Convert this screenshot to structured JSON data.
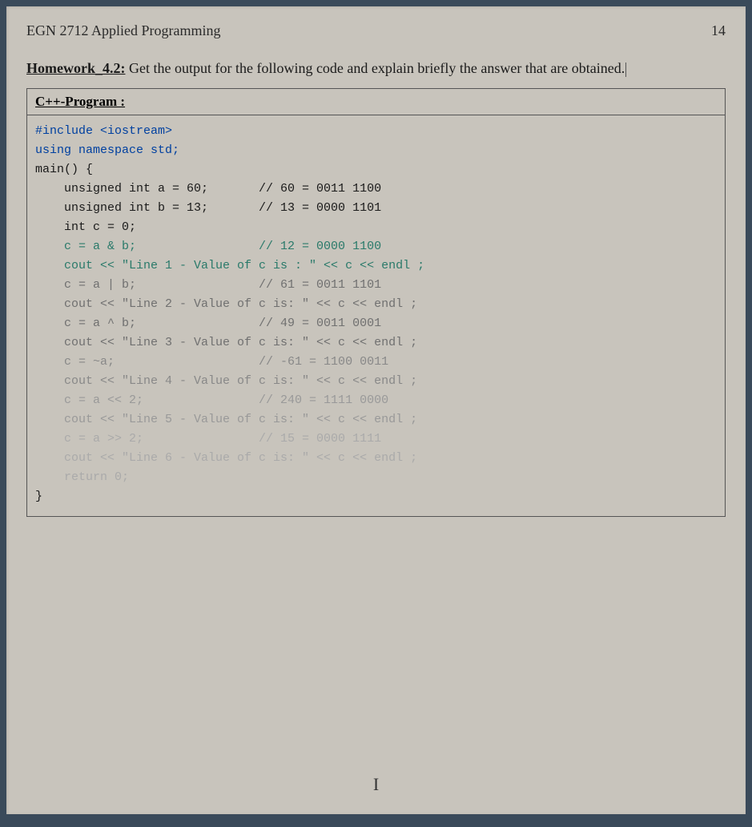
{
  "header": {
    "course": "EGN 2712 Applied Programming",
    "page_number": "14"
  },
  "homework": {
    "title": "Homework_4.2:",
    "prompt": " Get the output for the following code and explain briefly the answer that are obtained."
  },
  "program_label": "C++-Program :",
  "code": {
    "l01": "#include <iostream>",
    "l02": "using namespace std;",
    "l03": "",
    "l04": "main() {",
    "l05": "    unsigned int a = 60;       // 60 = 0011 1100",
    "l06": "    unsigned int b = 13;       // 13 = 0000 1101",
    "l07": "    int c = 0;",
    "l08": "",
    "l09": "    c = a & b;                 // 12 = 0000 1100",
    "l10": "    cout << \"Line 1 - Value of c is : \" << c << endl ;",
    "l11": "",
    "l12": "    c = a | b;                 // 61 = 0011 1101",
    "l13": "    cout << \"Line 2 - Value of c is: \" << c << endl ;",
    "l14": "",
    "l15": "    c = a ^ b;                 // 49 = 0011 0001",
    "l16": "    cout << \"Line 3 - Value of c is: \" << c << endl ;",
    "l17": "",
    "l18": "    c = ~a;                    // -61 = 1100 0011",
    "l19": "    cout << \"Line 4 - Value of c is: \" << c << endl ;",
    "l20": "",
    "l21": "    c = a << 2;                // 240 = 1111 0000",
    "l22": "    cout << \"Line 5 - Value of c is: \" << c << endl ;",
    "l23": "",
    "l24": "    c = a >> 2;                // 15 = 0000 1111",
    "l25": "    cout << \"Line 6 - Value of c is: \" << c << endl ;",
    "l26": "",
    "l27": "    return 0;",
    "l28": "}"
  },
  "caret": "I"
}
